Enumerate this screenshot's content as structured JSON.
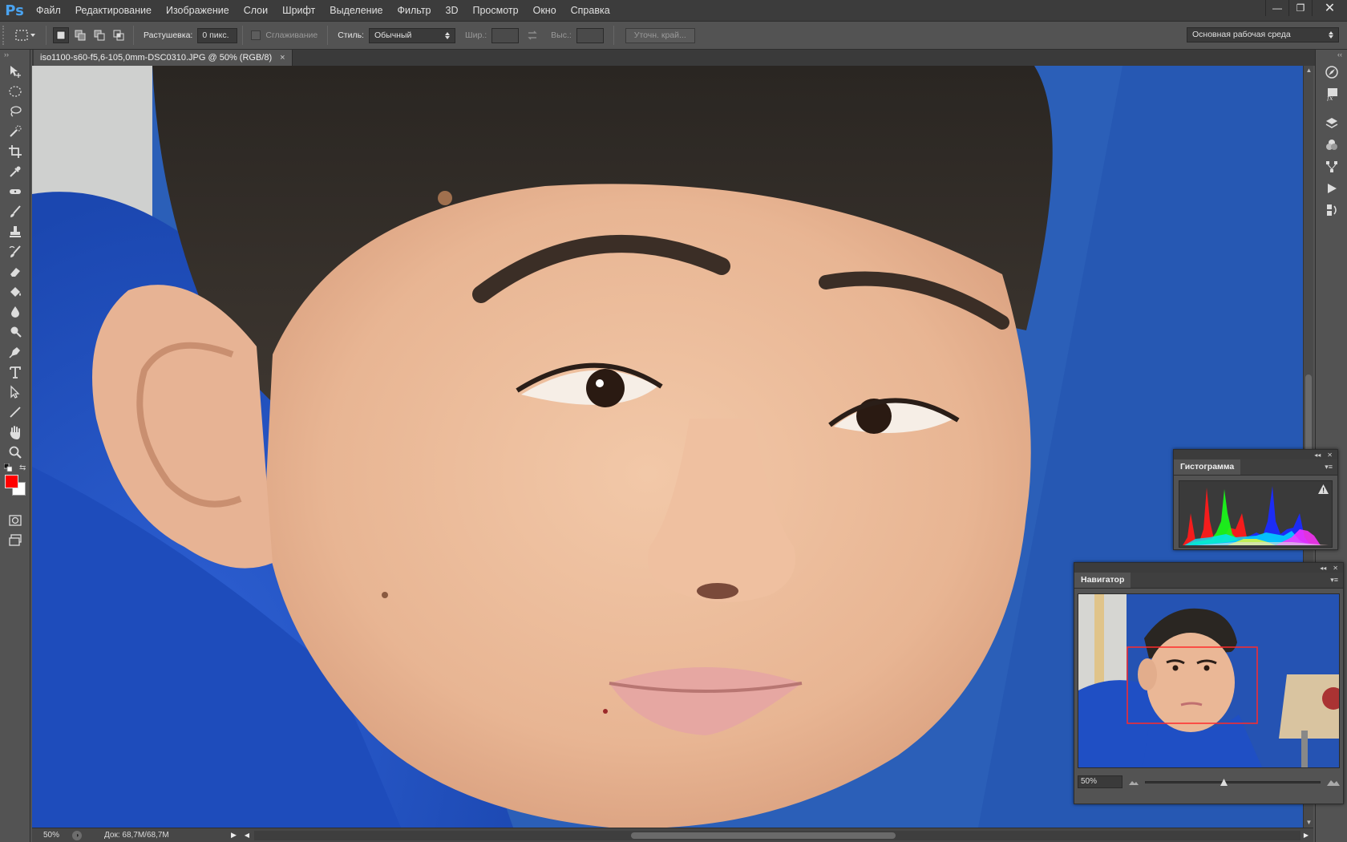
{
  "app": {
    "logo": "Ps"
  },
  "menu": [
    "Файл",
    "Редактирование",
    "Изображение",
    "Слои",
    "Шрифт",
    "Выделение",
    "Фильтр",
    "3D",
    "Просмотр",
    "Окно",
    "Справка"
  ],
  "window_controls": {
    "minimize": "—",
    "restore": "❐",
    "close": "✕"
  },
  "options": {
    "feather_label": "Растушевка:",
    "feather_value": "0 пикс.",
    "antialias_label": "Сглаживание",
    "style_label": "Стиль:",
    "style_value": "Обычный",
    "width_label": "Шир.:",
    "height_label": "Выс.:",
    "refine_edge": "Уточн. край...",
    "workspace": "Основная рабочая среда"
  },
  "document": {
    "tab_title": "iso1100-s60-f5,6-105,0mm-DSC0310.JPG @ 50% (RGB/8)",
    "tab_close": "×"
  },
  "tools": [
    "move-tool",
    "elliptical-marquee-tool",
    "lasso-tool",
    "quick-selection-tool",
    "crop-tool",
    "eyedropper-tool",
    "spot-healing-tool",
    "brush-tool",
    "clone-stamp-tool",
    "history-brush-tool",
    "eraser-tool",
    "paint-bucket-tool",
    "blur-tool",
    "dodge-tool",
    "pen-tool",
    "type-tool",
    "path-selection-tool",
    "line-tool",
    "hand-tool",
    "zoom-tool"
  ],
  "colors": {
    "foreground": "#ff0000",
    "background": "#ffffff"
  },
  "status": {
    "zoom": "50%",
    "doc_size": "Док: 68,7M/68,7M"
  },
  "histogram_panel": {
    "title": "Гистограмма"
  },
  "navigator_panel": {
    "title": "Навигатор",
    "zoom": "50%"
  },
  "right_dock": [
    "navigator-icon",
    "styles-icon",
    "layers-icon",
    "channels-icon",
    "paths-icon",
    "actions-icon",
    "history-icon"
  ]
}
